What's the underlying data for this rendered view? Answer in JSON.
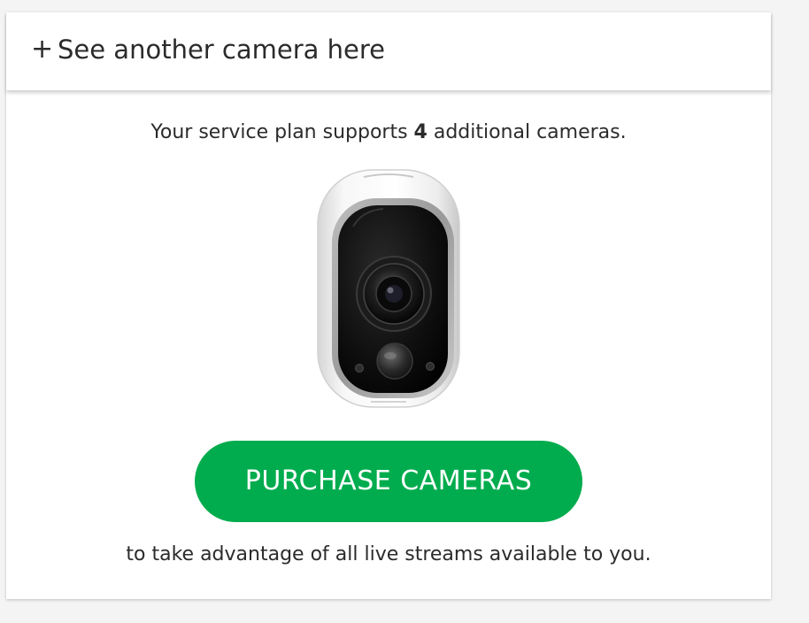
{
  "header": {
    "plus": "+",
    "title": "See another camera here"
  },
  "plan": {
    "prefix": "Your service plan supports ",
    "count": "4",
    "suffix": " additional cameras."
  },
  "camera_image": {
    "icon": "security-camera-icon"
  },
  "purchase": {
    "label": "PURCHASE CAMERAS",
    "color": "#00ac4d"
  },
  "footer": {
    "text": "to take advantage of all live streams available to you."
  }
}
